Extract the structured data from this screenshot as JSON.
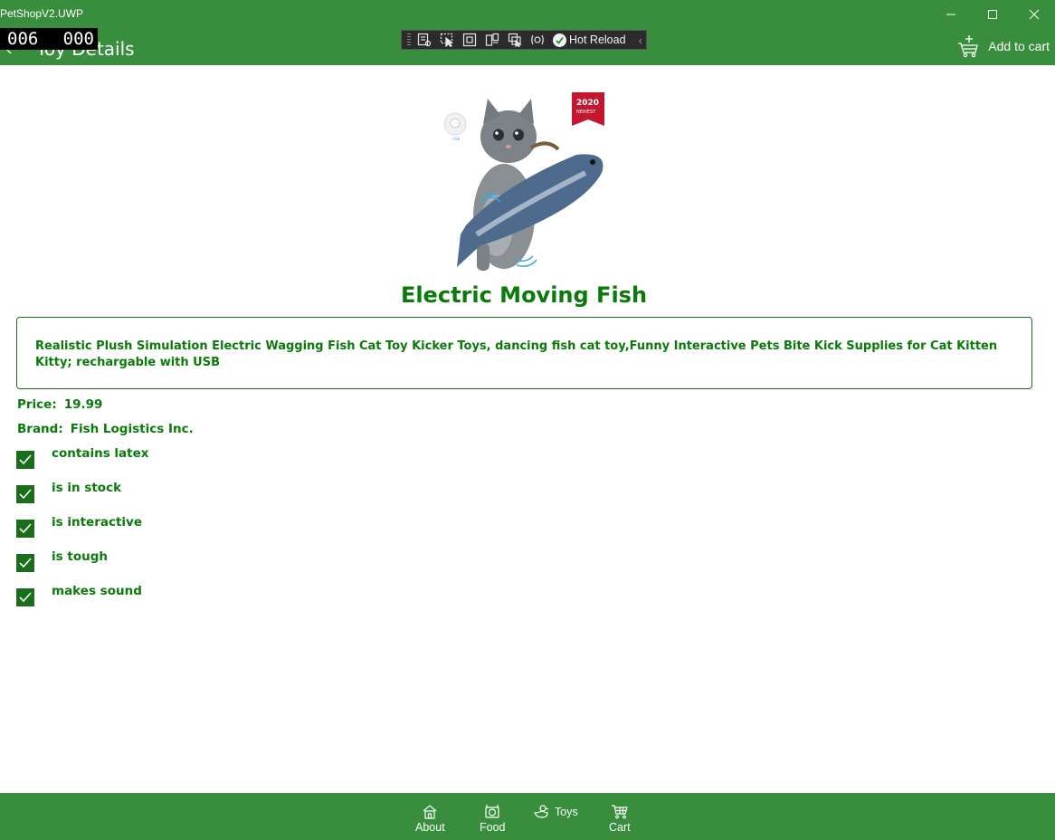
{
  "app": {
    "title": "PetShopV2.UWP"
  },
  "header": {
    "page_title": "Toy Details",
    "add_to_cart_label": "Add to cart"
  },
  "fps_counter": {
    "left": "006",
    "right": "000"
  },
  "debug_toolbar": {
    "hot_reload_label": "Hot Reload"
  },
  "product": {
    "name": "Electric Moving Fish",
    "description": "Realistic Plush Simulation Electric Wagging Fish Cat Toy Kicker Toys, dancing fish cat toy,Funny Interactive Pets Bite Kick Supplies for Cat Kitten Kitty; rechargable with USB",
    "price_label": "Price:",
    "price": "19.99",
    "brand_label": "Brand:",
    "brand": "Fish Logistics Inc.",
    "badge_year": "2020",
    "badge_text": "NEWEST",
    "features": [
      {
        "label": "contains latex",
        "checked": true
      },
      {
        "label": "is in stock",
        "checked": true
      },
      {
        "label": "is interactive",
        "checked": true
      },
      {
        "label": "is tough",
        "checked": true
      },
      {
        "label": "makes sound",
        "checked": true
      }
    ]
  },
  "bottom_nav": {
    "items": [
      {
        "label": "About",
        "icon": "home-icon"
      },
      {
        "label": "Food",
        "icon": "food-bowl-icon"
      },
      {
        "label": "Toys",
        "icon": "toy-duck-icon"
      },
      {
        "label": "Cart",
        "icon": "cart-icon"
      }
    ]
  },
  "colors": {
    "header_bg": "#388e3c",
    "text_green": "#0a7a0a",
    "checkbox": "#1a6d1a"
  }
}
